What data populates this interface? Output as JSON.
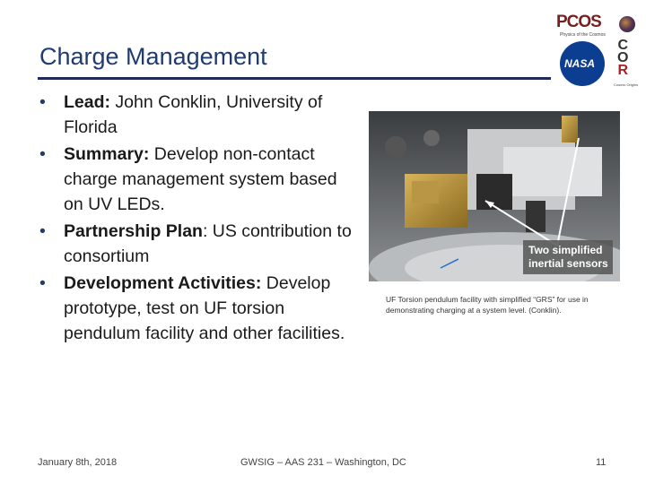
{
  "slide": {
    "title": "Charge Management"
  },
  "logos": {
    "pcos": "PCOS",
    "pcos_sub": "Physics of the Cosmos",
    "nasa": "NASA",
    "cor": [
      "C",
      "O",
      "R"
    ],
    "cor_sub": "Cosmic Origins"
  },
  "bullets": [
    {
      "label": "Lead:",
      "text": " John Conklin, University of Florida"
    },
    {
      "label": "Summary:",
      "text": " Develop non-contact charge management system based on UV LEDs."
    },
    {
      "label": "Partnership Plan",
      "text": ": US contribution to consortium"
    },
    {
      "label": "Development Activities:",
      "text": " Develop prototype, test on UF torsion pendulum facility and other facilities."
    }
  ],
  "photo": {
    "annotation": "Two simplified inertial sensors"
  },
  "caption": "UF Torsion pendulum facility with simplified “GRS” for use in demonstrating charging at a system level. (Conklin).",
  "footer": {
    "date": "January 8th, 2018",
    "conference": "GWSIG – AAS 231 – Washington, DC",
    "page": "11"
  },
  "colors": {
    "title": "#1f3b6f",
    "rule": "#1f2a55",
    "nasa_blue": "#0b3d91"
  }
}
